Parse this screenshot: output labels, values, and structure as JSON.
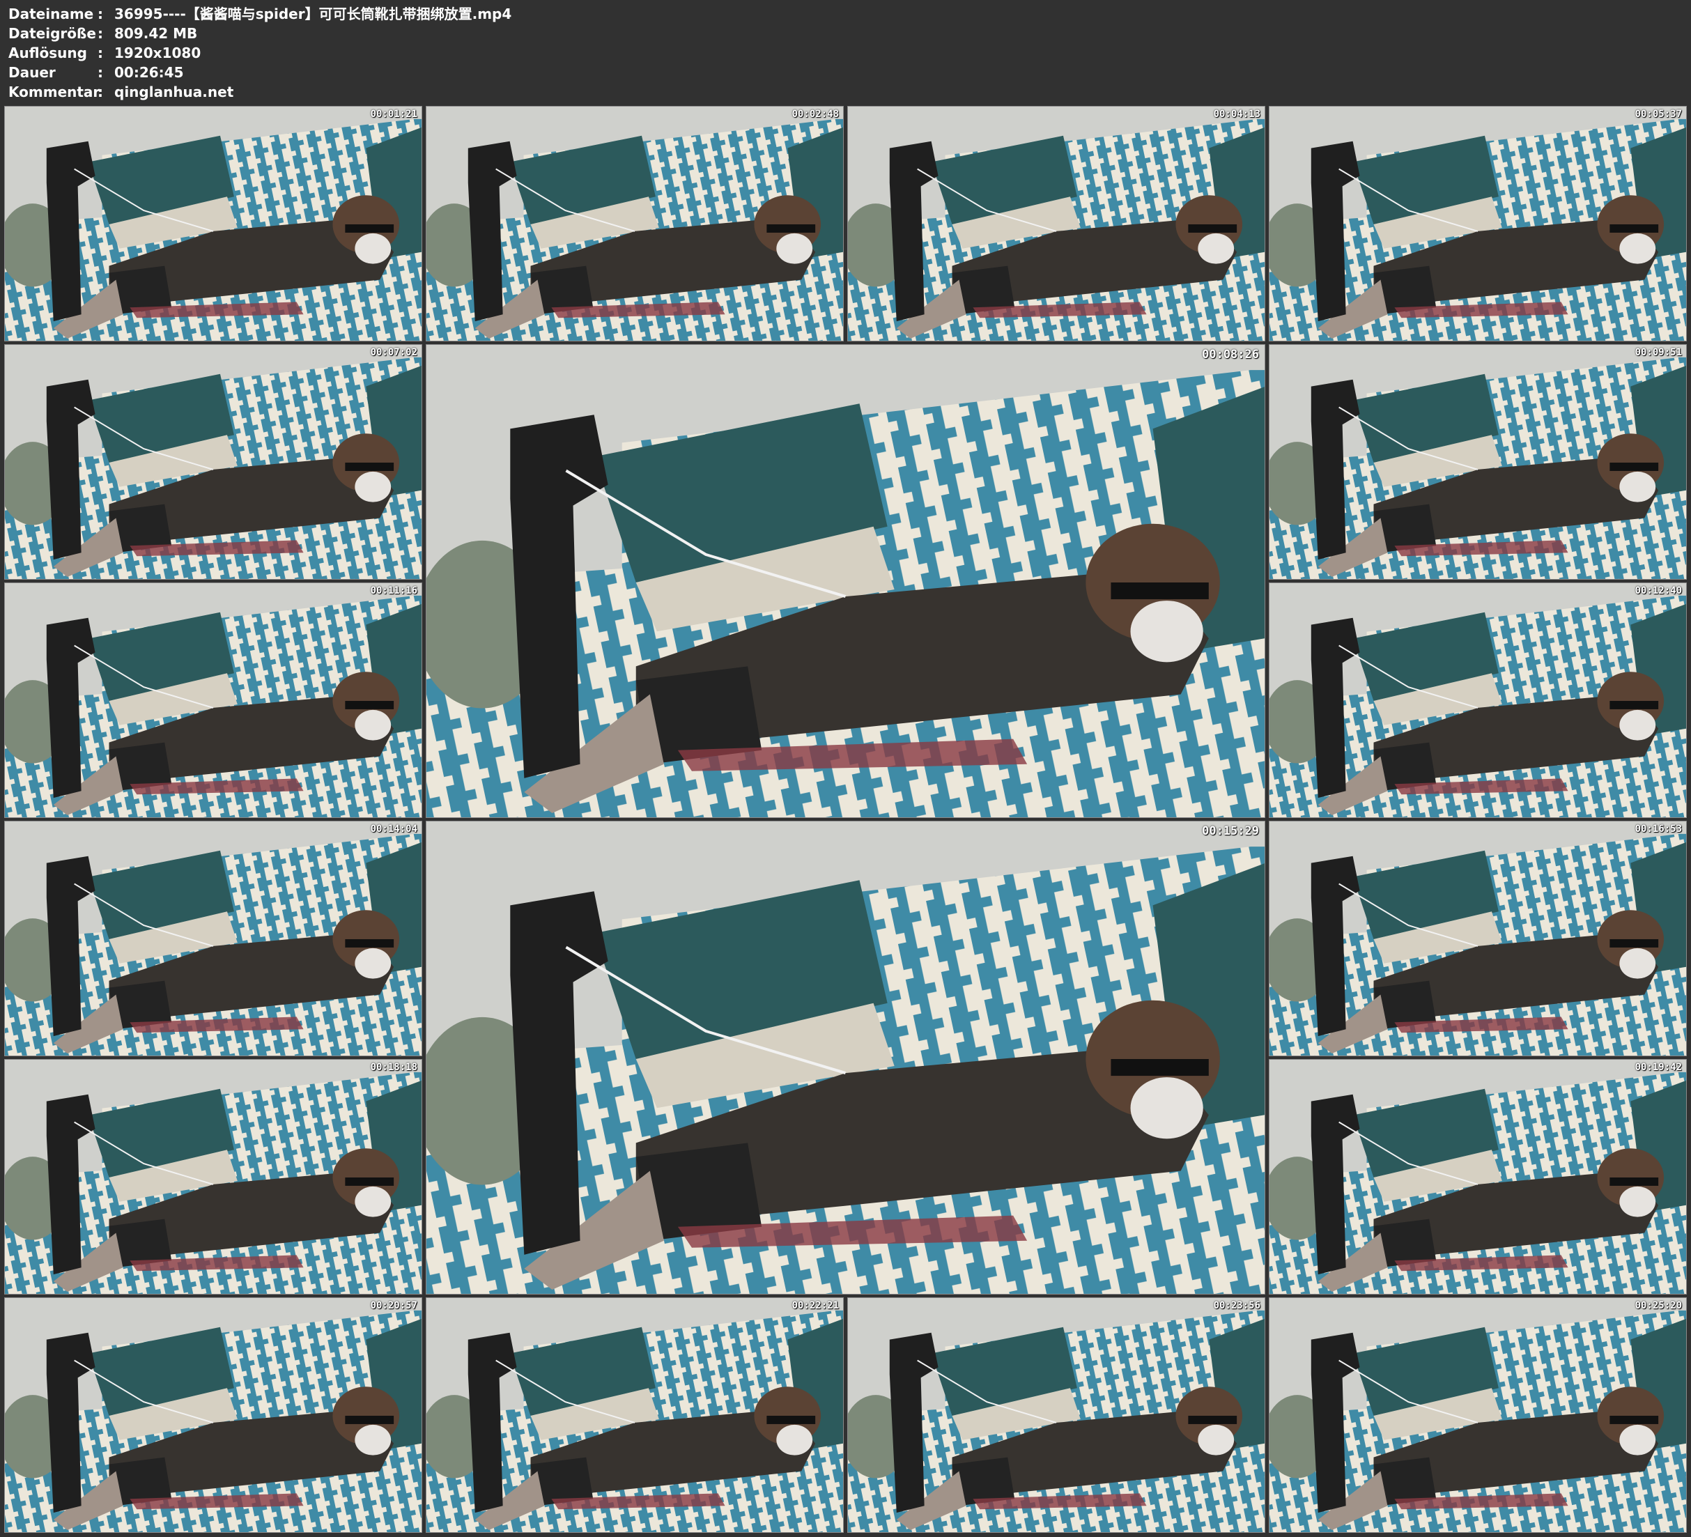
{
  "header": {
    "rows": [
      {
        "label": "Dateiname",
        "sep": ":",
        "value": "36995----【酱酱喵与spider】可可长筒靴扎带捆绑放置.mp4"
      },
      {
        "label": "Dateigröße",
        "sep": ":",
        "value": "809.42 MB"
      },
      {
        "label": "Auflösung",
        "sep": ":",
        "value": "1920x1080"
      },
      {
        "label": "Dauer",
        "sep": ":",
        "value": "00:26:45"
      },
      {
        "label": "Kommentar",
        "sep": ":",
        "value": "qinglanhua.net"
      }
    ]
  },
  "colors": {
    "page_background": "#313131",
    "wall": "#cfd0cc",
    "sofa_blue": "#3f8ba6",
    "sofa_cream": "#ece7da",
    "pillow_teal": "#2c5a5c",
    "jacket": "#37332f",
    "boots": "#1f1f1f",
    "skin": "#a19389"
  },
  "thumbnails": [
    {
      "timestamp": "00:01:21",
      "size": "small"
    },
    {
      "timestamp": "00:02:48",
      "size": "small"
    },
    {
      "timestamp": "00:04:13",
      "size": "small"
    },
    {
      "timestamp": "00:05:37",
      "size": "small"
    },
    {
      "timestamp": "00:07:02",
      "size": "small"
    },
    {
      "timestamp": "00:08:26",
      "size": "large"
    },
    {
      "timestamp": "00:09:51",
      "size": "small"
    },
    {
      "timestamp": "00:11:16",
      "size": "small"
    },
    {
      "timestamp": "00:12:40",
      "size": "small"
    },
    {
      "timestamp": "00:14:04",
      "size": "small"
    },
    {
      "timestamp": "00:15:29",
      "size": "large"
    },
    {
      "timestamp": "00:16:53",
      "size": "small"
    },
    {
      "timestamp": "00:18:18",
      "size": "small"
    },
    {
      "timestamp": "00:19:42",
      "size": "small"
    },
    {
      "timestamp": "00:20:57",
      "size": "small"
    },
    {
      "timestamp": "00:22:21",
      "size": "small"
    },
    {
      "timestamp": "00:23:56",
      "size": "small"
    },
    {
      "timestamp": "00:25:20",
      "size": "small"
    }
  ]
}
